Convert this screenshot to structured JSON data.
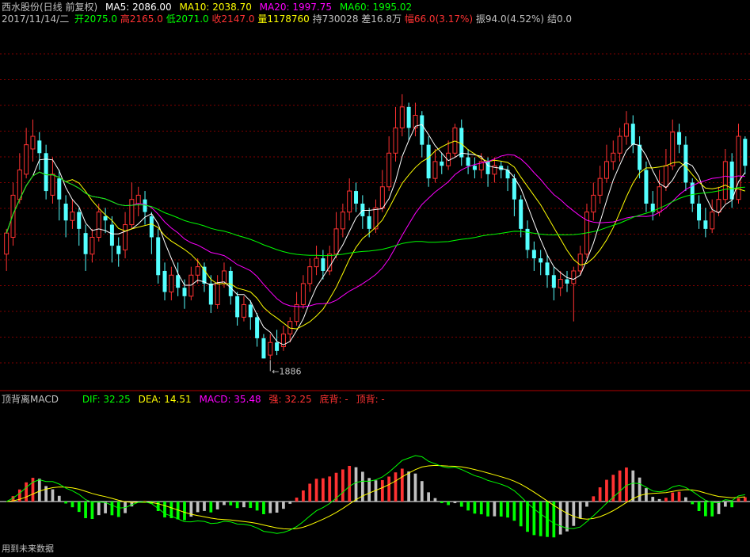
{
  "header": {
    "stock": "西水股份(日线 前复权)",
    "ma5": "MA5: 2086.00",
    "ma10": "MA10: 2038.70",
    "ma20": "MA20: 1997.75",
    "ma60": "MA60: 1995.02",
    "date": "2017/11/14/二",
    "open": "开2075.0",
    "high": "高2165.0",
    "low": "低2071.0",
    "close": "收2147.0",
    "volume": "量1178760",
    "hold": "持730028",
    "diff": "差16.8万",
    "amp_chg": "幅66.0(3.17%)",
    "swing": "振94.0(4.52%)",
    "settle": "结0.0"
  },
  "macd_panel": {
    "name": "顶背离MACD",
    "dif": "DIF: 32.25",
    "dea": "DEA: 14.51",
    "macd": "MACD: 35.48",
    "strong": "强: 32.25",
    "bottom_div": "底背: -",
    "top_div": "顶背: -",
    "footnote": "用到未来数据"
  },
  "colors": {
    "up": "#ff3232",
    "down": "#54ffff",
    "ma5": "#ffffff",
    "ma10": "#ffff00",
    "ma20": "#ff00ff",
    "ma60": "#00ff00",
    "grid": "#800000",
    "hist_up": "#ff3232",
    "hist_down_pos": "#c0c0c0",
    "hist_down_neg": "#00ff00",
    "hist_up_neg": "#c0c0c0"
  },
  "chart_data": {
    "type": "candlestick",
    "price_range": [
      1860,
      2280
    ],
    "low_annotation": {
      "label": "1886",
      "value": 1886
    },
    "candles": [
      [
        2010,
        2035,
        1990,
        2040
      ],
      [
        2030,
        2080,
        2020,
        2095
      ],
      [
        2075,
        2110,
        2070,
        2130
      ],
      [
        2105,
        2140,
        2100,
        2160
      ],
      [
        2135,
        2150,
        2120,
        2170
      ],
      [
        2145,
        2130,
        2110,
        2155
      ],
      [
        2130,
        2085,
        2075,
        2140
      ],
      [
        2080,
        2105,
        2070,
        2125
      ],
      [
        2100,
        2075,
        2050,
        2110
      ],
      [
        2070,
        2050,
        2030,
        2080
      ],
      [
        2050,
        2060,
        2040,
        2075
      ],
      [
        2060,
        2040,
        2020,
        2065
      ],
      [
        2035,
        2010,
        1990,
        2045
      ],
      [
        2010,
        2030,
        2000,
        2040
      ],
      [
        2030,
        2060,
        2025,
        2070
      ],
      [
        2055,
        2050,
        2035,
        2065
      ],
      [
        2045,
        2020,
        2000,
        2055
      ],
      [
        2020,
        2010,
        1995,
        2030
      ],
      [
        2015,
        2045,
        2005,
        2060
      ],
      [
        2045,
        2075,
        2040,
        2095
      ],
      [
        2070,
        2080,
        2055,
        2090
      ],
      [
        2075,
        2060,
        2045,
        2085
      ],
      [
        2055,
        2030,
        2010,
        2060
      ],
      [
        2030,
        1985,
        1975,
        2040
      ],
      [
        1990,
        1965,
        1955,
        2000
      ],
      [
        1965,
        1985,
        1955,
        1995
      ],
      [
        1985,
        1970,
        1960,
        2000
      ],
      [
        1970,
        1960,
        1945,
        1980
      ],
      [
        1960,
        1985,
        1955,
        1995
      ],
      [
        1985,
        1995,
        1975,
        2005
      ],
      [
        1995,
        1975,
        1965,
        2000
      ],
      [
        1975,
        1950,
        1940,
        1985
      ],
      [
        1950,
        1975,
        1945,
        1985
      ],
      [
        1975,
        1990,
        1970,
        2000
      ],
      [
        1990,
        1960,
        1950,
        1995
      ],
      [
        1960,
        1935,
        1925,
        1965
      ],
      [
        1935,
        1950,
        1930,
        1960
      ],
      [
        1950,
        1935,
        1920,
        1955
      ],
      [
        1935,
        1910,
        1900,
        1940
      ],
      [
        1910,
        1886,
        1886,
        1915
      ],
      [
        1890,
        1905,
        1885,
        1915
      ],
      [
        1905,
        1895,
        1890,
        1920
      ],
      [
        1900,
        1915,
        1895,
        1925
      ],
      [
        1915,
        1930,
        1905,
        1935
      ],
      [
        1930,
        1950,
        1925,
        1965
      ],
      [
        1950,
        1975,
        1945,
        1985
      ],
      [
        1975,
        1995,
        1965,
        2005
      ],
      [
        1995,
        2005,
        1985,
        2020
      ],
      [
        2005,
        1990,
        1980,
        2015
      ],
      [
        1990,
        2010,
        1985,
        2020
      ],
      [
        2010,
        2040,
        2005,
        2060
      ],
      [
        2040,
        2060,
        2030,
        2070
      ],
      [
        2060,
        2085,
        2050,
        2100
      ],
      [
        2085,
        2070,
        2060,
        2095
      ],
      [
        2070,
        2055,
        2040,
        2080
      ],
      [
        2055,
        2040,
        2030,
        2065
      ],
      [
        2040,
        2065,
        2035,
        2075
      ],
      [
        2065,
        2090,
        2060,
        2110
      ],
      [
        2090,
        2130,
        2085,
        2150
      ],
      [
        2130,
        2160,
        2120,
        2185
      ],
      [
        2160,
        2185,
        2150,
        2200
      ],
      [
        2185,
        2160,
        2145,
        2190
      ],
      [
        2160,
        2175,
        2150,
        2190
      ],
      [
        2175,
        2140,
        2125,
        2180
      ],
      [
        2140,
        2100,
        2090,
        2150
      ],
      [
        2100,
        2120,
        2095,
        2135
      ],
      [
        2120,
        2115,
        2105,
        2130
      ],
      [
        2115,
        2130,
        2110,
        2145
      ],
      [
        2130,
        2160,
        2125,
        2165
      ],
      [
        2160,
        2125,
        2115,
        2170
      ],
      [
        2125,
        2115,
        2105,
        2135
      ],
      [
        2115,
        2110,
        2100,
        2125
      ],
      [
        2110,
        2120,
        2100,
        2130
      ],
      [
        2120,
        2105,
        2090,
        2125
      ],
      [
        2105,
        2115,
        2095,
        2125
      ],
      [
        2115,
        2110,
        2100,
        2120
      ],
      [
        2110,
        2100,
        2085,
        2115
      ],
      [
        2100,
        2075,
        2055,
        2105
      ],
      [
        2075,
        2040,
        2030,
        2080
      ],
      [
        2040,
        2015,
        2005,
        2050
      ],
      [
        2015,
        2005,
        1990,
        2025
      ],
      [
        2005,
        2000,
        1985,
        2015
      ],
      [
        2000,
        1985,
        1970,
        2010
      ],
      [
        1985,
        1970,
        1955,
        1995
      ],
      [
        1970,
        1980,
        1960,
        1990
      ],
      [
        1980,
        1975,
        1965,
        1990
      ],
      [
        1975,
        1990,
        1930,
        1995
      ],
      [
        1990,
        2010,
        1985,
        2020
      ],
      [
        2010,
        2060,
        2005,
        2070
      ],
      [
        2060,
        2080,
        2050,
        2095
      ],
      [
        2080,
        2100,
        2070,
        2115
      ],
      [
        2100,
        2120,
        2095,
        2140
      ],
      [
        2120,
        2130,
        2110,
        2145
      ],
      [
        2130,
        2150,
        2120,
        2160
      ],
      [
        2150,
        2165,
        2140,
        2180
      ],
      [
        2165,
        2140,
        2130,
        2175
      ],
      [
        2140,
        2110,
        2100,
        2150
      ],
      [
        2110,
        2070,
        2060,
        2120
      ],
      [
        2070,
        2060,
        2050,
        2085
      ],
      [
        2060,
        2090,
        2055,
        2110
      ],
      [
        2090,
        2115,
        2085,
        2135
      ],
      [
        2115,
        2155,
        2110,
        2170
      ],
      [
        2155,
        2140,
        2130,
        2165
      ],
      [
        2140,
        2095,
        2085,
        2150
      ],
      [
        2095,
        2070,
        2060,
        2100
      ],
      [
        2070,
        2050,
        2040,
        2080
      ],
      [
        2050,
        2040,
        2030,
        2065
      ],
      [
        2040,
        2060,
        2035,
        2075
      ],
      [
        2060,
        2075,
        2055,
        2090
      ],
      [
        2075,
        2120,
        2070,
        2135
      ],
      [
        2120,
        2075,
        2065,
        2130
      ],
      [
        2075,
        2150,
        2070,
        2165
      ],
      [
        2147,
        2115,
        2105,
        2150
      ]
    ]
  }
}
